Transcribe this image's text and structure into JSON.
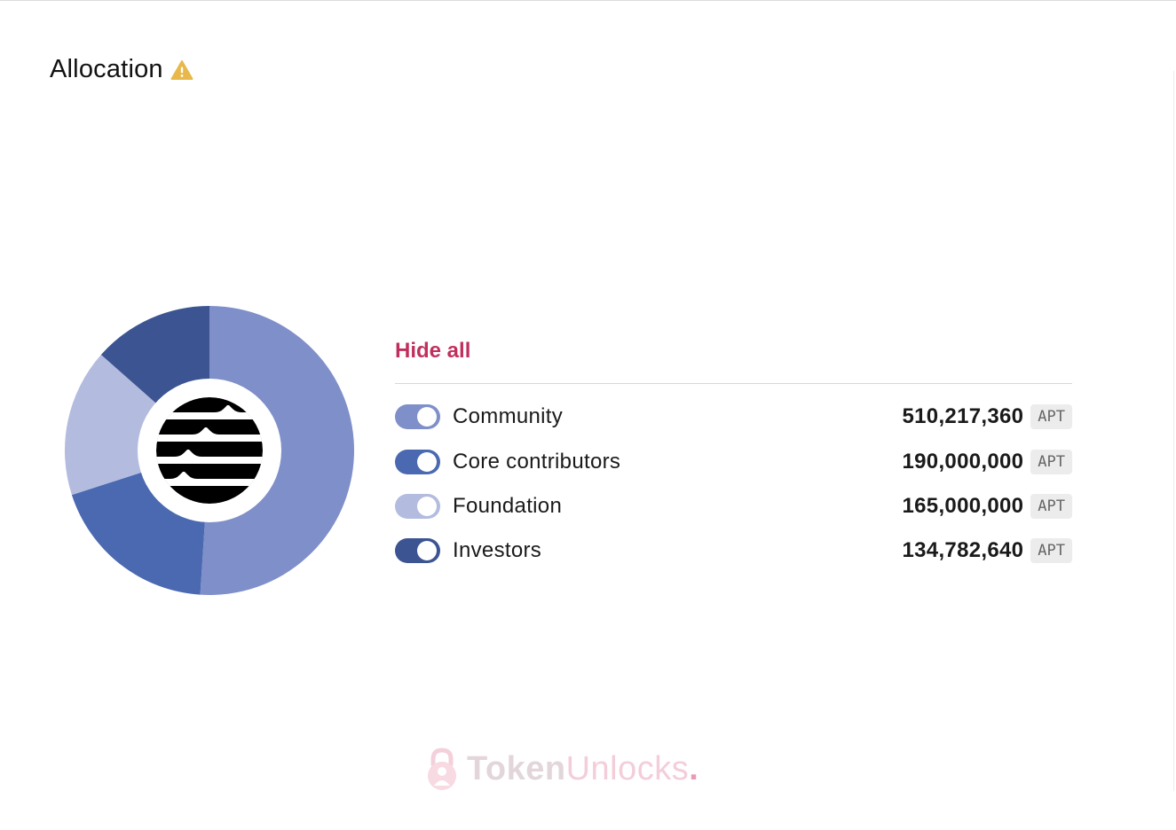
{
  "header": {
    "title": "Allocation",
    "icon": "warning-icon"
  },
  "legend": {
    "hide_all_label": "Hide all"
  },
  "chart_data": {
    "type": "pie",
    "style": "donut",
    "categories": [
      "Community",
      "Core contributors",
      "Foundation",
      "Investors"
    ],
    "values": [
      510217360,
      190000000,
      165000000,
      134782640
    ],
    "unit": "APT",
    "value_labels": [
      "510,217,360",
      "190,000,000",
      "165,000,000",
      "134,782,640"
    ],
    "colors": [
      "#7f8fc9",
      "#4a69b1",
      "#b3bcdf",
      "#3c5492"
    ],
    "center_logo": "aptos-logo-icon"
  },
  "watermark": {
    "part1": "Token",
    "part2": "Unlocks",
    "part3": ".",
    "icon": "lock-icon"
  },
  "colors": {
    "accent": "#c0305e",
    "warning": "#e8b84b"
  }
}
